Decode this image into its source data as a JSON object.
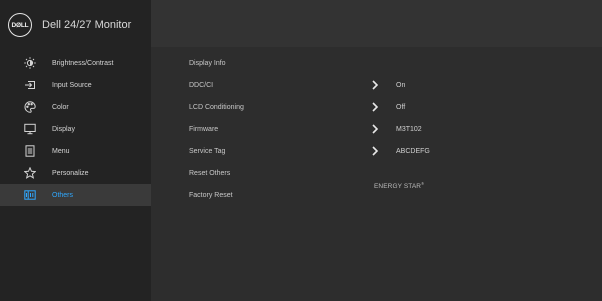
{
  "brand": {
    "logo_text": "DØLL",
    "title": "Dell 24/27 Monitor"
  },
  "colors": {
    "accent": "#2fa8ff",
    "text": "#d4d4d4",
    "sidebar_bg": "#232323",
    "panel_bg": "#2d2d2d"
  },
  "sidebar": {
    "items": [
      {
        "label": "Brightness/Contrast",
        "icon": "brightness-icon"
      },
      {
        "label": "Input Source",
        "icon": "input-source-icon"
      },
      {
        "label": "Color",
        "icon": "color-palette-icon"
      },
      {
        "label": "Display",
        "icon": "display-icon"
      },
      {
        "label": "Menu",
        "icon": "menu-icon"
      },
      {
        "label": "Personalize",
        "icon": "star-icon"
      },
      {
        "label": "Others",
        "icon": "others-icon",
        "selected": true
      }
    ]
  },
  "options": [
    {
      "label": "Display Info",
      "value": ""
    },
    {
      "label": "DDC/CI",
      "value": "On",
      "has_arrow": true
    },
    {
      "label": "LCD Conditioning",
      "value": "Off",
      "has_arrow": true
    },
    {
      "label": "Firmware",
      "value": "M3T102",
      "has_arrow": true
    },
    {
      "label": "Service Tag",
      "value": "ABCDEFG",
      "has_arrow": true
    },
    {
      "label": "Reset Others",
      "value": ""
    },
    {
      "label": "Factory Reset",
      "value": ""
    }
  ],
  "energy_star": {
    "text": "ENERGY STAR",
    "mark": "®"
  }
}
